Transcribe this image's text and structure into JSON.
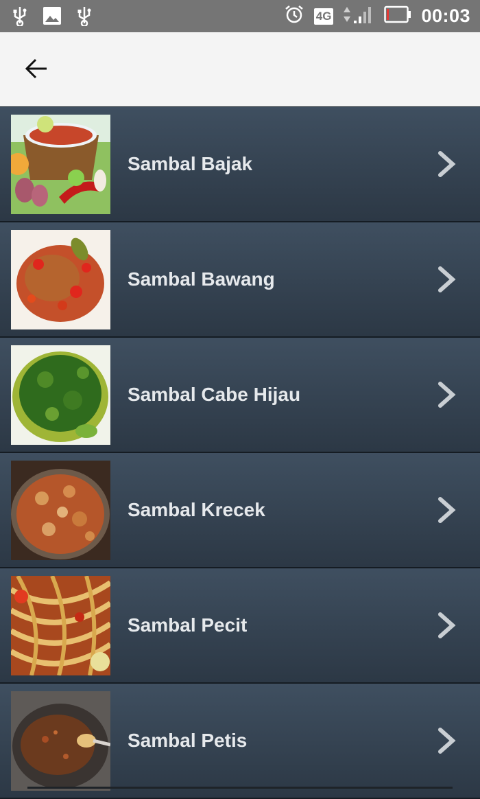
{
  "status_bar": {
    "left_icons": [
      "usb-icon",
      "image-icon",
      "usb-icon"
    ],
    "network": "4G",
    "time": "00:03"
  },
  "app_bar": {
    "back_icon": "arrow-left-icon"
  },
  "list": {
    "items": [
      {
        "label": "Sambal Bajak",
        "image": "sambal-bajak-image"
      },
      {
        "label": "Sambal Bawang",
        "image": "sambal-bawang-image"
      },
      {
        "label": "Sambal Cabe Hijau",
        "image": "sambal-cabe-hijau-image"
      },
      {
        "label": "Sambal Krecek",
        "image": "sambal-krecek-image"
      },
      {
        "label": "Sambal Pecit",
        "image": "sambal-pecit-image"
      },
      {
        "label": "Sambal Petis",
        "image": "sambal-petis-image"
      }
    ]
  },
  "colors": {
    "status_bar": "#757575",
    "app_bar": "#f4f4f4",
    "row_top": "#3f4f60",
    "row_bottom": "#2c3845",
    "label": "#e6e9ec"
  }
}
